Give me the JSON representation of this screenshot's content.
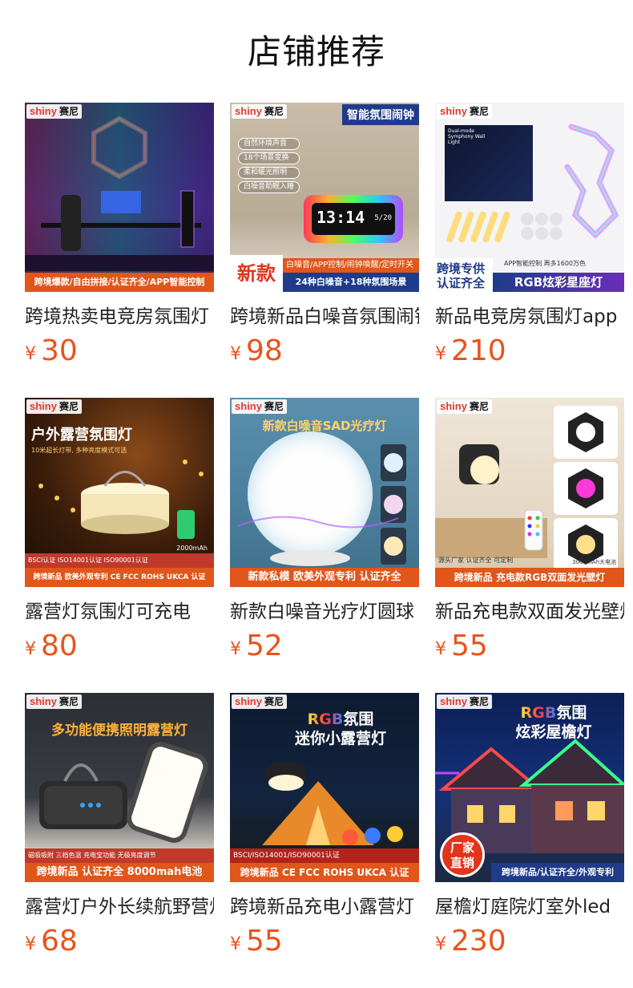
{
  "page_title": "店铺推荐",
  "currency": "¥",
  "logo": {
    "en": "shiny",
    "cn": "赛尼"
  },
  "products": [
    {
      "name": "跨境热卖电竞房氛围灯",
      "price": "30",
      "img": {
        "banner": "跨境爆款/自由拼接/认证齐全/APP智能控制"
      }
    },
    {
      "name": "跨境新品白噪音氛围闹钟",
      "price": "98",
      "img": {
        "headline": "智能氛围闹钟",
        "features": [
          "自然环境声音",
          "18个场景变换",
          "柔和暖光照明",
          "白噪音助眠入睡"
        ],
        "clock": "13:14",
        "date": "5/20",
        "tag": "新款",
        "strip": "白噪音/APP控制/闹钟唤醒/定时开关",
        "banner": "24种白噪音+18种氛围场景"
      }
    },
    {
      "name": "新品电竞房氛围灯app",
      "price": "210",
      "img": {
        "box": "Dual-mode Symphony Wall Light",
        "left_tag": "跨境专供\n认证齐全",
        "small": "APP智能控制  再多1600万色",
        "banner": "RGB炫彩星座灯"
      }
    },
    {
      "name": "露营灯氛围灯可充电",
      "price": "80",
      "img": {
        "headline": "户外露营氛围灯",
        "sub": "10米超长灯带, 多种亮度模式可选",
        "battery": "2000mAh",
        "cert": "BSCI认证  ISO14001认证  ISO90001认证",
        "banner": "跨境新品  欧美外观专利  CE FCC ROHS UKCA 认证"
      }
    },
    {
      "name": "新款白噪音光疗灯圆球",
      "price": "52",
      "img": {
        "headline": "新款白噪音SAD光疗灯",
        "banner": "新款私模  欧美外观专利  认证齐全"
      }
    },
    {
      "name": "新品充电款双面发光壁灯",
      "price": "55",
      "img": {
        "small": "源头厂家  认证齐全  可定制",
        "battery": "3000mAh大电池",
        "banner": "跨境新品  充电款RGB双面发光壁灯"
      }
    },
    {
      "name": "露营灯户外长续航野营灯",
      "price": "68",
      "img": {
        "headline": "多功能便携照明露营灯",
        "small": "磁吸吸附  三档色温  充电宝功能  无极亮度调节",
        "banner": "跨境新品  认证齐全  8000mah电池"
      }
    },
    {
      "name": "跨境新品充电小露营灯",
      "price": "55",
      "img": {
        "headline_rgb": "RGB",
        "headline_rest": "氛围",
        "headline2": "迷你小露营灯",
        "cert": "BSCI/ISO14001/ISO90001认证",
        "banner": "跨境新品 CE FCC ROHS UKCA 认证"
      }
    },
    {
      "name": "屋檐灯庭院灯室外led",
      "price": "230",
      "img": {
        "headline_rgb": "RGB",
        "headline_rest": "氛围",
        "headline2": "炫彩屋檐灯",
        "stamp": "厂家\n直销",
        "banner": "跨境新品/认证齐全/外观专利"
      }
    }
  ],
  "colors": {
    "price": "#e8541c",
    "title": "#111111",
    "name": "#222222"
  }
}
